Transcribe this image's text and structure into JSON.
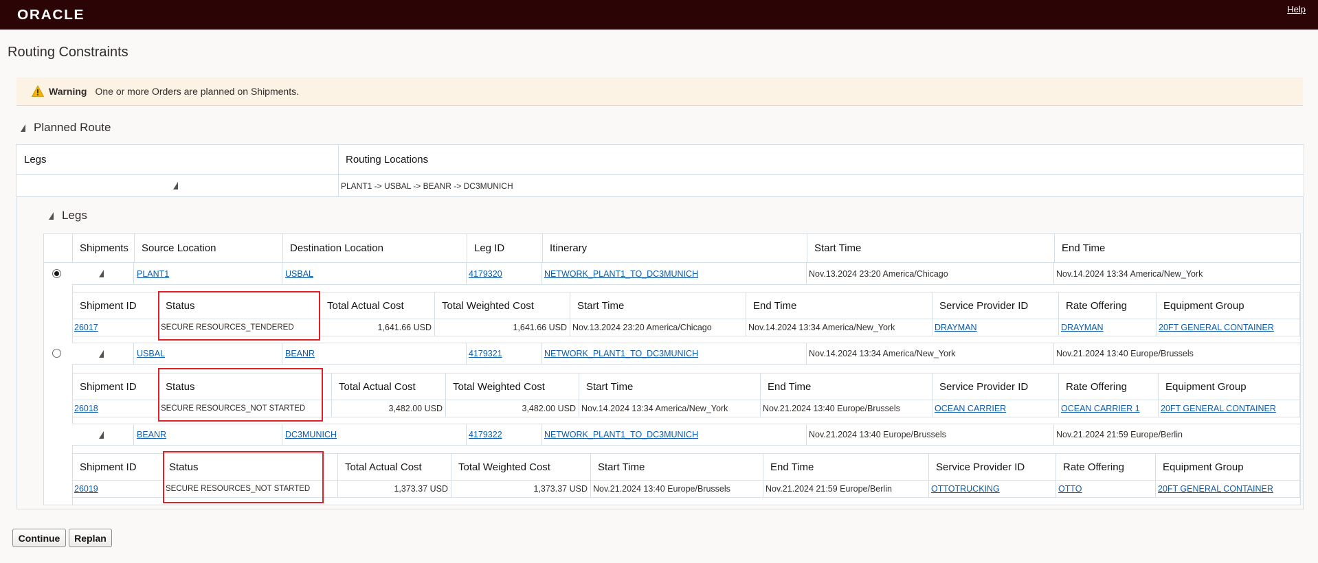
{
  "header": {
    "logo": "ORACLE",
    "help": "Help"
  },
  "page": {
    "title": "Routing Constraints"
  },
  "warning": {
    "label": "Warning",
    "text": "One or more Orders are planned on Shipments."
  },
  "planned_route": {
    "title": "Planned Route",
    "columns": [
      "Legs",
      "Routing Locations"
    ],
    "routing_locations": "PLANT1 -> USBAL -> BEANR -> DC3MUNICH"
  },
  "legs": {
    "title": "Legs",
    "columns": [
      "Shipments",
      "Source Location",
      "Destination Location",
      "Leg ID",
      "Itinerary",
      "Start Time",
      "End Time"
    ],
    "rows": [
      {
        "selected": true,
        "source": "PLANT1",
        "destination": "USBAL",
        "leg_id": "4179320",
        "itinerary": "NETWORK_PLANT1_TO_DC3MUNICH",
        "start": "Nov.13.2024 23:20 America/Chicago",
        "end": "Nov.14.2024 13:34 America/New_York"
      },
      {
        "selected": false,
        "source": "USBAL",
        "destination": "BEANR",
        "leg_id": "4179321",
        "itinerary": "NETWORK_PLANT1_TO_DC3MUNICH",
        "start": "Nov.14.2024 13:34 America/New_York",
        "end": "Nov.21.2024 13:40 Europe/Brussels"
      },
      {
        "selected": false,
        "source": "BEANR",
        "destination": "DC3MUNICH",
        "leg_id": "4179322",
        "itinerary": "NETWORK_PLANT1_TO_DC3MUNICH",
        "start": "Nov.21.2024 13:40 Europe/Brussels",
        "end": "Nov.21.2024 21:59 Europe/Berlin"
      }
    ]
  },
  "shipments": {
    "columns": [
      "Shipment ID",
      "Status",
      "Total Actual Cost",
      "Total Weighted Cost",
      "Start Time",
      "End Time",
      "Service Provider ID",
      "Rate Offering",
      "Equipment Group"
    ],
    "rows": [
      {
        "id": "26017",
        "status": "SECURE RESOURCES_TENDERED",
        "actual": "1,641.66 USD",
        "weighted": "1,641.66 USD",
        "start": "Nov.13.2024 23:20 America/Chicago",
        "end": "Nov.14.2024 13:34 America/New_York",
        "provider": "DRAYMAN",
        "rate": "DRAYMAN",
        "equipment": "20FT GENERAL CONTAINER"
      },
      {
        "id": "26018",
        "status": "SECURE RESOURCES_NOT STARTED",
        "actual": "3,482.00 USD",
        "weighted": "3,482.00 USD",
        "start": "Nov.14.2024 13:34 America/New_York",
        "end": "Nov.21.2024 13:40 Europe/Brussels",
        "provider": "OCEAN CARRIER",
        "rate": "OCEAN CARRIER 1",
        "equipment": "20FT GENERAL CONTAINER"
      },
      {
        "id": "26019",
        "status": "SECURE RESOURCES_NOT STARTED",
        "actual": "1,373.37 USD",
        "weighted": "1,373.37 USD",
        "start": "Nov.21.2024 13:40 Europe/Brussels",
        "end": "Nov.21.2024 21:59 Europe/Berlin",
        "provider": "OTTOTRUCKING",
        "rate": "OTTO",
        "equipment": "20FT GENERAL CONTAINER"
      }
    ]
  },
  "buttons": {
    "continue": "Continue",
    "replan": "Replan"
  }
}
